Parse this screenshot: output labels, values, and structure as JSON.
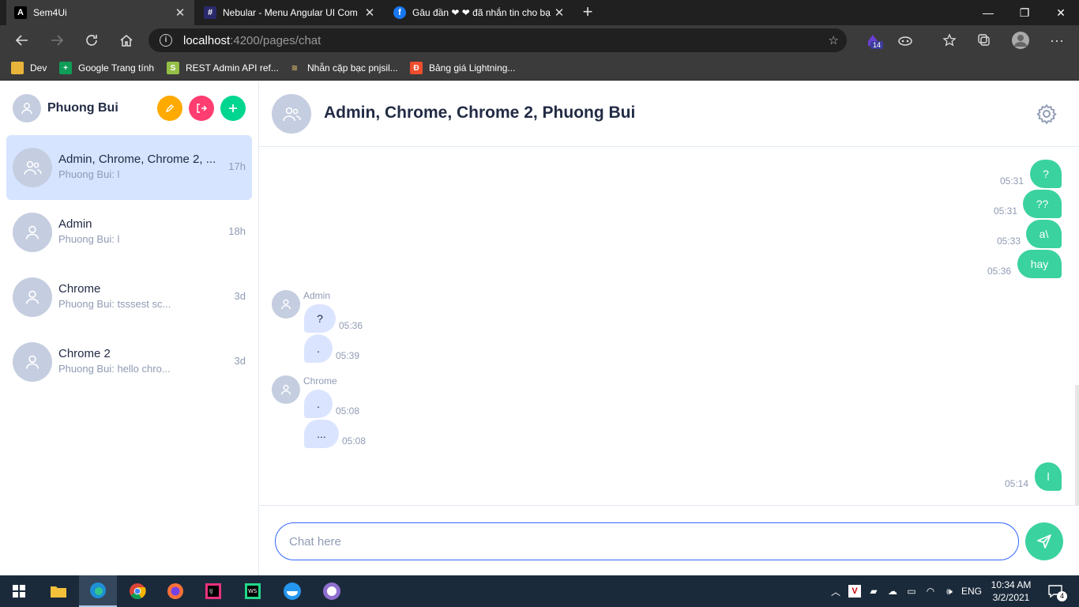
{
  "browser": {
    "tabs": [
      {
        "title": "Sem4Ui"
      },
      {
        "title": "Nebular - Menu Angular UI Com"
      },
      {
        "title": "Gâu đần ❤ ❤ đã nhắn tin cho bạ"
      }
    ],
    "url_host": "localhost",
    "url_rest": ":4200/pages/chat",
    "extension_badge": "14",
    "bookmarks": [
      {
        "label": "Dev"
      },
      {
        "label": "Google Trang tính"
      },
      {
        "label": "REST Admin API ref..."
      },
      {
        "label": "Nhẫn cặp bạc pnjsil..."
      },
      {
        "label": "Bảng giá Lightning..."
      }
    ]
  },
  "sidebar": {
    "user_name": "Phuong Bui",
    "conversations": [
      {
        "name": "Admin, Chrome, Chrome 2, ...",
        "preview": "Phuong Bui: l",
        "time": "17h"
      },
      {
        "name": "Admin",
        "preview": "Phuong Bui: l",
        "time": "18h"
      },
      {
        "name": "Chrome",
        "preview": "Phuong Bui: tsssest sc...",
        "time": "3d"
      },
      {
        "name": "Chrome 2",
        "preview": "Phuong Bui: hello chro...",
        "time": "3d"
      }
    ]
  },
  "chat": {
    "title": "Admin, Chrome, Chrome 2, Phuong Bui",
    "outgoing_top": [
      {
        "text": "?",
        "time": "05:31"
      },
      {
        "text": "??",
        "time": "05:31"
      },
      {
        "text": "a\\",
        "time": "05:33"
      },
      {
        "text": "hay",
        "time": "05:36"
      }
    ],
    "groups": [
      {
        "sender": "Admin",
        "messages": [
          {
            "text": "?",
            "time": "05:36"
          },
          {
            "text": ".",
            "time": "05:39"
          }
        ]
      },
      {
        "sender": "Chrome",
        "messages": [
          {
            "text": ".",
            "time": "05:08"
          },
          {
            "text": "...",
            "time": "05:08"
          }
        ]
      }
    ],
    "outgoing_bottom": [
      {
        "text": "l",
        "time": "05:14"
      }
    ],
    "input_placeholder": "Chat here"
  },
  "taskbar": {
    "language": "ENG",
    "time": "10:34 AM",
    "date": "3/2/2021",
    "notification_count": "4"
  }
}
